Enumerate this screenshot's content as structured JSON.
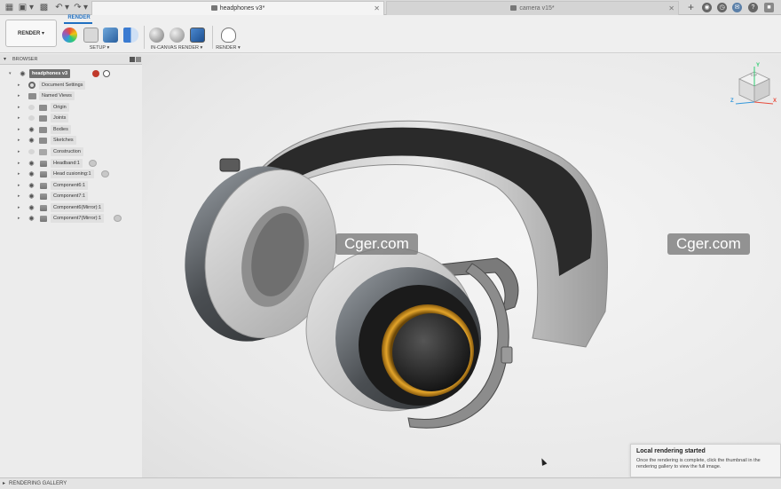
{
  "tabs": [
    {
      "label": "headphones v3*",
      "active": true
    },
    {
      "label": "camera v15*",
      "active": false
    }
  ],
  "ribbon": {
    "workspace_label": "RENDER ▾",
    "active_tab": "RENDER",
    "groups": [
      {
        "label": "SETUP ▾"
      },
      {
        "label": "IN-CANVAS RENDER ▾"
      },
      {
        "label": "RENDER ▾"
      }
    ]
  },
  "browser": {
    "title": "BROWSER",
    "items": [
      {
        "label": "headphones v3",
        "root": true
      },
      {
        "label": "Document Settings"
      },
      {
        "label": "Named Views"
      },
      {
        "label": "Origin"
      },
      {
        "label": "Joints"
      },
      {
        "label": "Bodies"
      },
      {
        "label": "Sketches"
      },
      {
        "label": "Construction"
      },
      {
        "label": "Headband:1"
      },
      {
        "label": "Head cusioning:1"
      },
      {
        "label": "Component6:1"
      },
      {
        "label": "Component7:1"
      },
      {
        "label": "Component6(Mirror):1"
      },
      {
        "label": "Component7(Mirror):1"
      }
    ]
  },
  "watermarks": [
    "Cger.com",
    "Cger.com"
  ],
  "viewcube": {
    "face": "TOP",
    "axes": [
      "Z",
      "X",
      "Y"
    ]
  },
  "status": {
    "label": "RENDERING GALLERY"
  },
  "toast": {
    "title": "Local rendering started",
    "body": "Once the rendering is complete, click the thumbnail in the rendering gallery to view the full image."
  },
  "colors": {
    "accent": "#1f6fc1",
    "gold_ring": "#d79a1e",
    "headband": "#2a2a2a",
    "cushion": "#cfcfcf"
  }
}
